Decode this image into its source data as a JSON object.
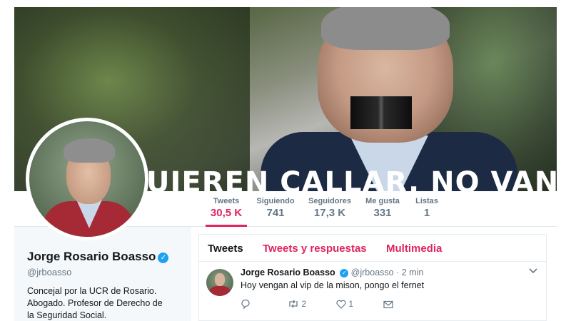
{
  "banner": {
    "text": "UIEREN CALLAR, NO VAN"
  },
  "nav": [
    {
      "label": "Tweets",
      "value": "30,5 K",
      "active": true
    },
    {
      "label": "Siguiendo",
      "value": "741"
    },
    {
      "label": "Seguidores",
      "value": "17,3 K"
    },
    {
      "label": "Me gusta",
      "value": "331"
    },
    {
      "label": "Listas",
      "value": "1"
    }
  ],
  "profile": {
    "name": "Jorge Rosario Boasso",
    "handle": "@jrboasso",
    "bio": "Concejal por la UCR de Rosario. Abogado. Profesor de Derecho de la Seguridad Social."
  },
  "tabs": [
    {
      "label": "Tweets",
      "active": true
    },
    {
      "label": "Tweets y respuestas"
    },
    {
      "label": "Multimedia"
    }
  ],
  "tweet": {
    "name": "Jorge Rosario Boasso",
    "handle": "@jrboasso",
    "separator": "·",
    "time": "2 min",
    "text": "Hoy vengan al vip de la mison, pongo el fernet",
    "retweets": "2",
    "likes": "1"
  },
  "colors": {
    "accent": "#e0245e",
    "verified": "#1da1f2",
    "muted": "#657786"
  }
}
